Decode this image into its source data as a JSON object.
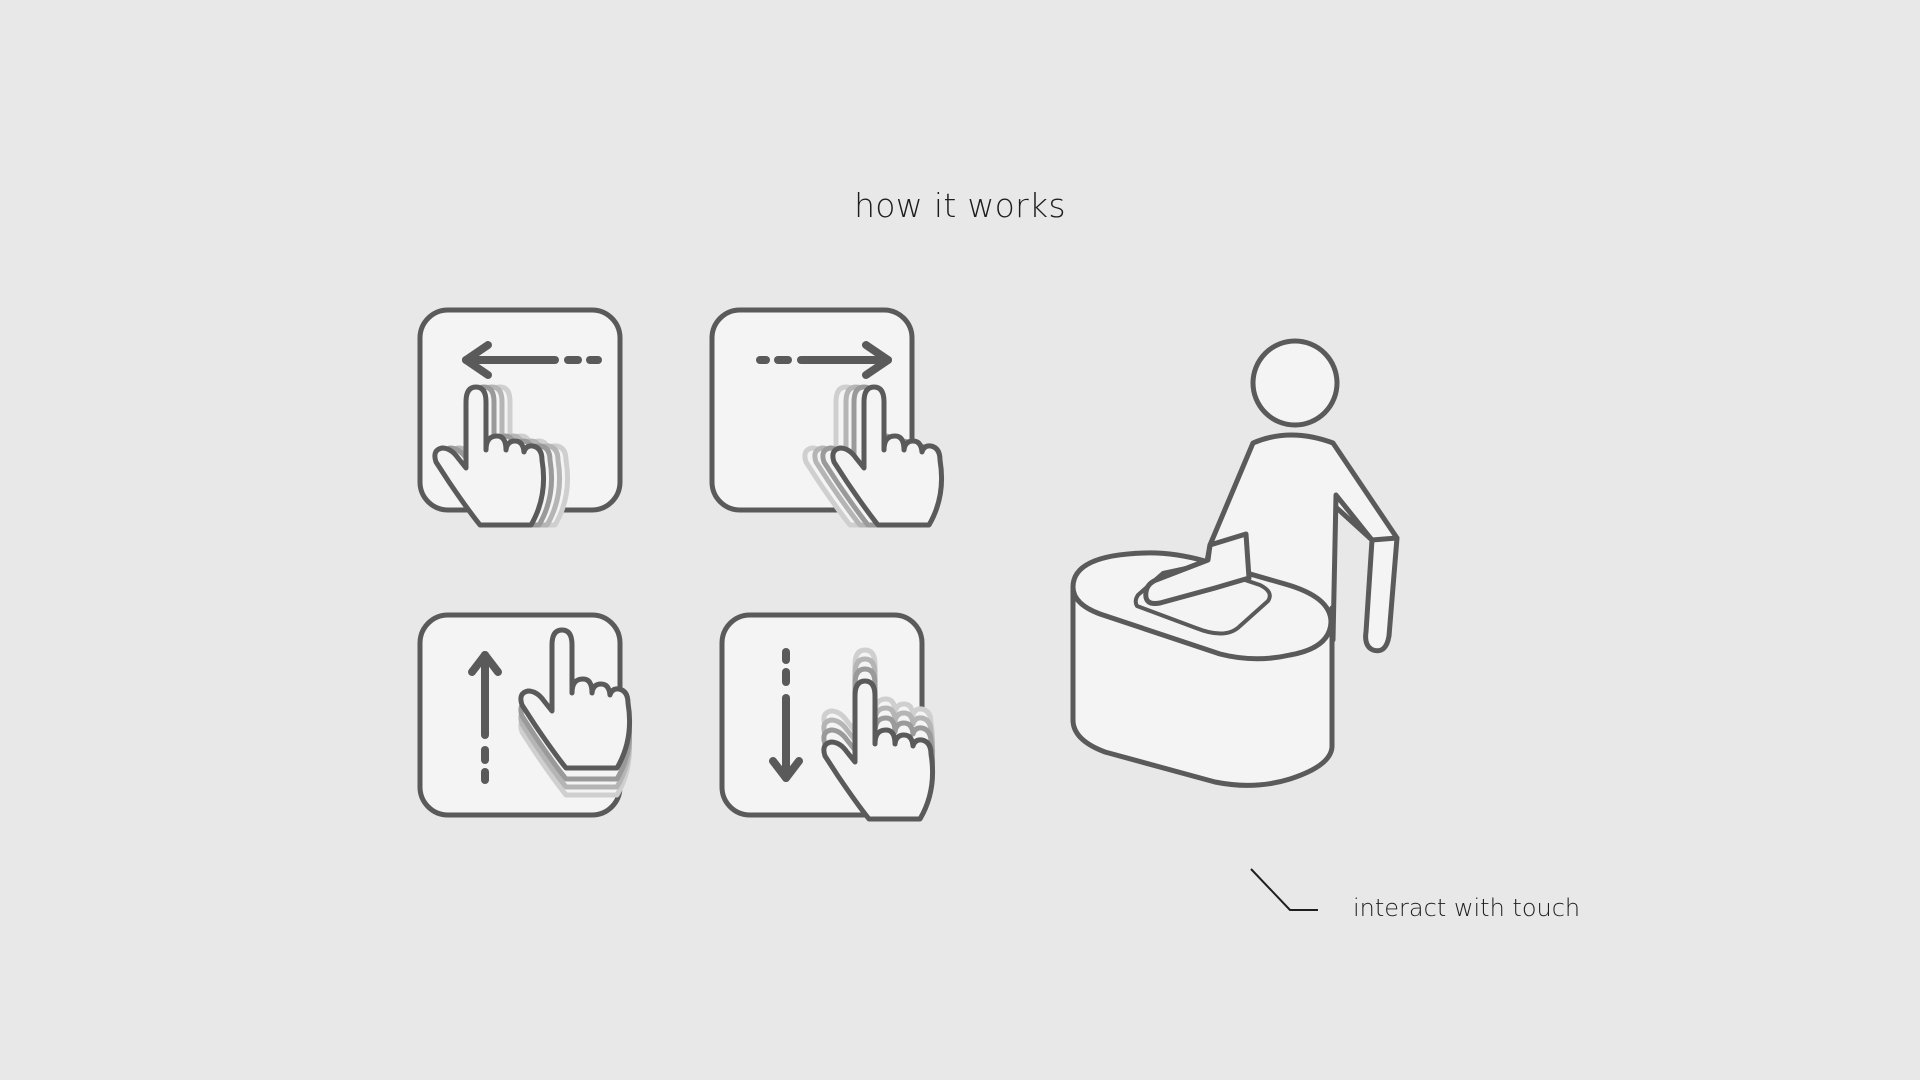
{
  "header": {
    "title": "how it works"
  },
  "gestures": [
    {
      "name": "swipe-left",
      "direction": "left"
    },
    {
      "name": "swipe-right",
      "direction": "right"
    },
    {
      "name": "swipe-up",
      "direction": "up"
    },
    {
      "name": "swipe-down",
      "direction": "down"
    }
  ],
  "caption": {
    "text": "interact with touch"
  },
  "colors": {
    "background": "#e8e8e8",
    "stroke": "#5a5a5a",
    "fill": "#f4f4f4",
    "ghost_dark": "#9a9a9a",
    "ghost_light": "#c8c8c8",
    "text": "#1e1e1e"
  },
  "icons": [
    "tap-hand-icon",
    "arrow-left-icon",
    "arrow-right-icon",
    "arrow-up-icon",
    "arrow-down-icon",
    "person-icon",
    "touch-table-icon"
  ]
}
